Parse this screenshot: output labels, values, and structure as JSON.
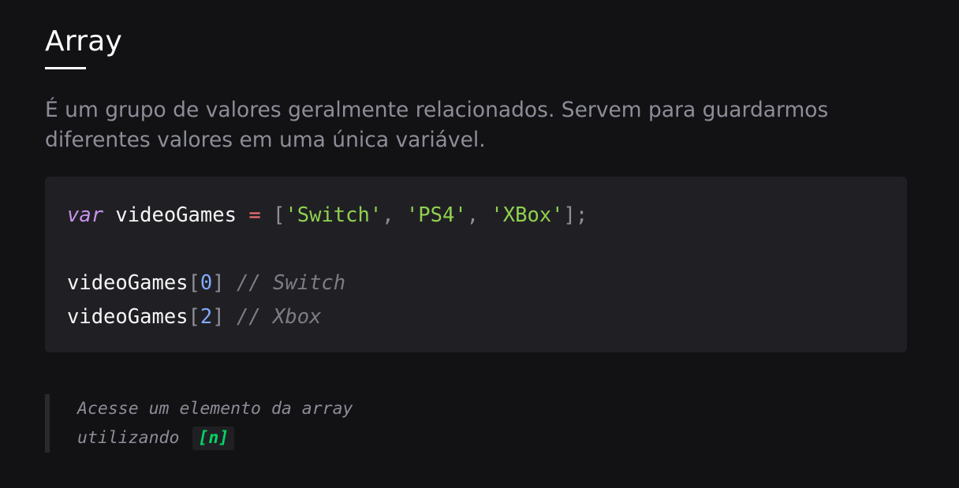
{
  "page": {
    "title": "Array",
    "description": "É um grupo de valores geralmente relacionados. Servem para guardarmos diferentes valores em uma única variável."
  },
  "code": {
    "line1": {
      "keyword": "var",
      "identifier": "videoGames",
      "operator": "=",
      "open_bracket": "[",
      "items": [
        "'Switch'",
        "'PS4'",
        "'XBox'"
      ],
      "separator": ",",
      "close": "];"
    },
    "line2": {
      "identifier": "videoGames",
      "open_bracket": "[",
      "index": "0",
      "close_bracket": "]",
      "comment": "// Switch"
    },
    "line3": {
      "identifier": "videoGames",
      "open_bracket": "[",
      "index": "2",
      "close_bracket": "]",
      "comment": "// Xbox"
    }
  },
  "note": {
    "line1": "Acesse um elemento da array",
    "line2": "utilizando",
    "inline_code": "[n]"
  },
  "colors": {
    "background": "#121214",
    "code_background": "#202024",
    "keyword": "#c792ea",
    "string": "#8fd14f",
    "number": "#82aaff",
    "operator": "#f07178",
    "inline_code": "#04d361"
  }
}
